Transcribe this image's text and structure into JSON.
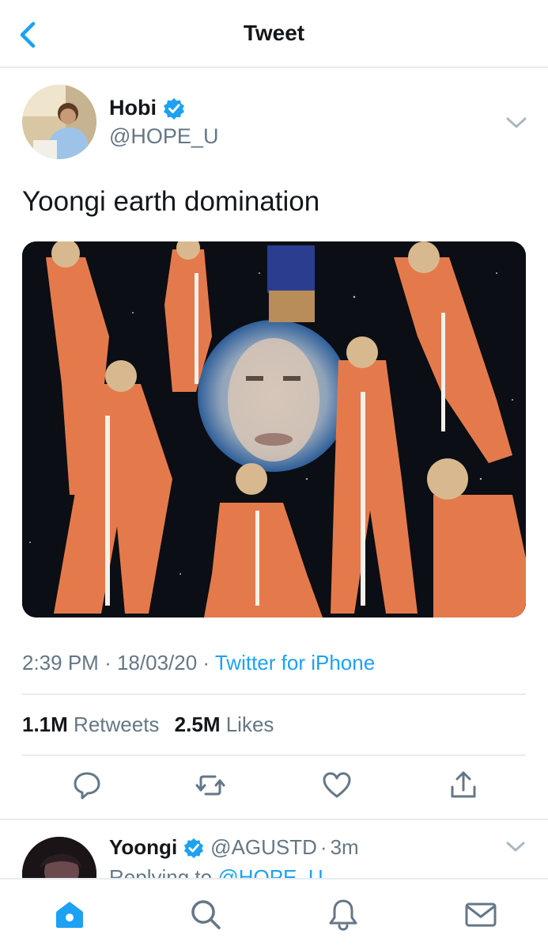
{
  "header": {
    "title": "Tweet"
  },
  "tweet": {
    "author_name": "Hobi",
    "author_handle": "@HOPE_U",
    "text": "Yoongi earth domination",
    "time": "2:39 PM",
    "date": "18/03/20",
    "source": "Twitter for iPhone",
    "retweets_count": "1.1M",
    "retweets_label": "Retweets",
    "likes_count": "2.5M",
    "likes_label": "Likes"
  },
  "reply": {
    "author_name": "Yoongi",
    "author_handle": "@AGUSTD",
    "age": "3m",
    "replying_prefix": "Replying to",
    "replying_to": "@HOPE_U"
  },
  "icons": {
    "back": "chevron-left-icon",
    "more": "chevron-down-icon",
    "verified": "verified-badge-icon",
    "reply": "comment-icon",
    "retweet": "retweet-icon",
    "like": "heart-icon",
    "share": "share-icon",
    "home": "home-icon",
    "search": "search-icon",
    "notifications": "bell-icon",
    "messages": "mail-icon"
  },
  "colors": {
    "accent": "#1da1f2",
    "secondary_text": "#657786",
    "primary_text": "#14171a",
    "divider": "#e6ecf0",
    "verified": "#1da1f2"
  }
}
